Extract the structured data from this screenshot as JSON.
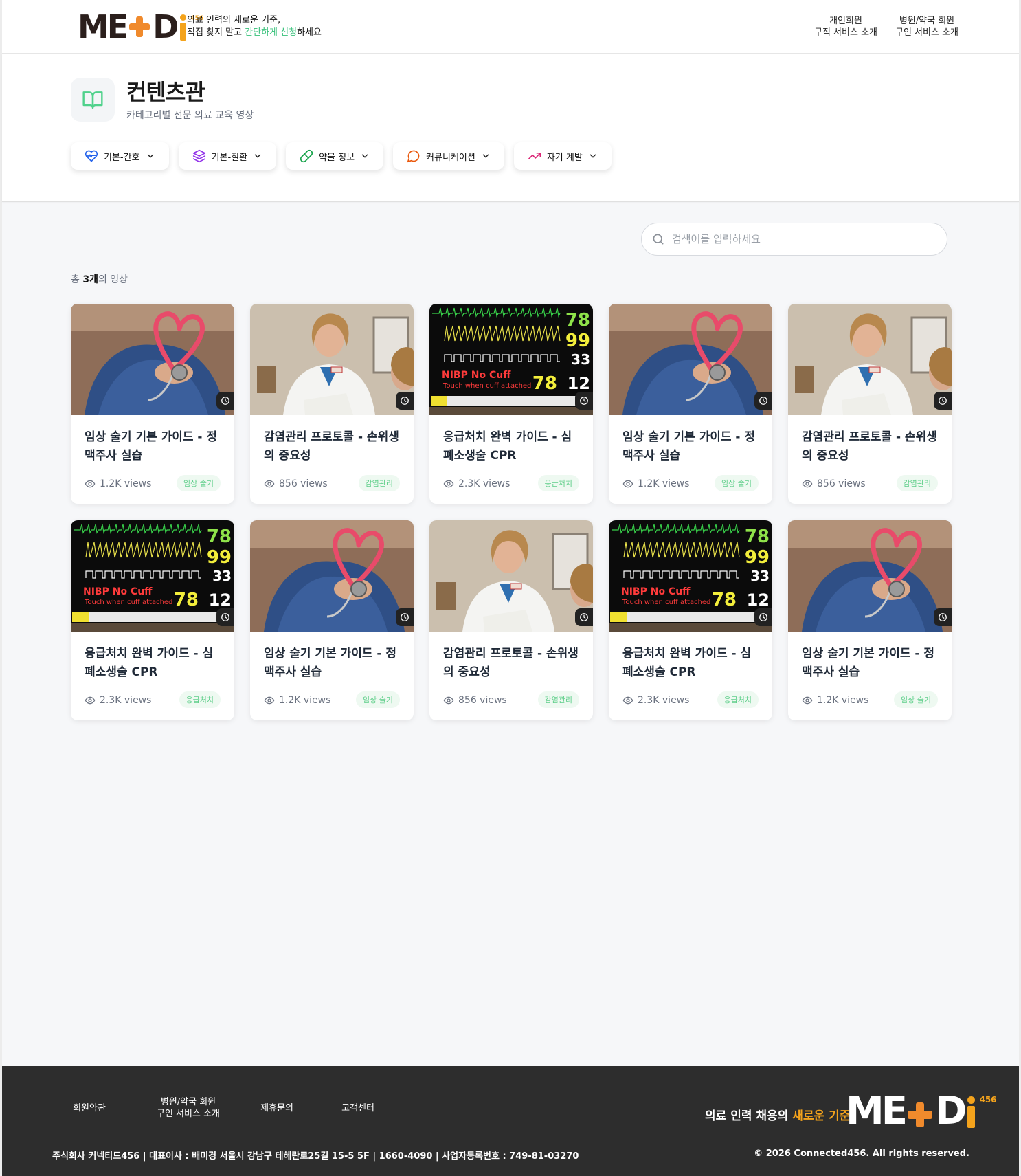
{
  "header": {
    "logo_text": "MEDi",
    "logo_sup": "456",
    "tagline_line1": "의료 인력의 새로운 기준,",
    "tagline_pre": "직접 찾지 말고 ",
    "tagline_green": "간단하게 신청",
    "tagline_post": "하세요",
    "nav": [
      {
        "line1": "개인회원",
        "line2": "구직 서비스 소개"
      },
      {
        "line1": "병원/약국 회원",
        "line2": "구인 서비스 소개"
      }
    ]
  },
  "hero": {
    "icon": "book-open-icon",
    "title": "컨텐츠관",
    "subtitle": "카테고리별 전문 의료 교육 영상",
    "categories": [
      {
        "label": "기본-간호",
        "icon": "heart-pulse-icon",
        "color": "#2563eb"
      },
      {
        "label": "기본-질환",
        "icon": "layers-icon",
        "color": "#9333ea"
      },
      {
        "label": "약물 정보",
        "icon": "pill-icon",
        "color": "#16a34a"
      },
      {
        "label": "커뮤니케이션",
        "icon": "message-circle-icon",
        "color": "#ea580c"
      },
      {
        "label": "자기 계발",
        "icon": "trending-up-icon",
        "color": "#db2777"
      }
    ]
  },
  "search": {
    "placeholder": "검색어를 입력하세요"
  },
  "count": {
    "prefix": "총 ",
    "value": "3개",
    "suffix": "의 영상"
  },
  "videos": [
    {
      "title": "임상 술기 기본 가이드 - 정맥주사 실습",
      "views": "1.2K views",
      "tag": "임상 술기",
      "thumb": "heart"
    },
    {
      "title": "감염관리 프로토콜 - 손위생의 중요성",
      "views": "856 views",
      "tag": "감염관리",
      "thumb": "doctor"
    },
    {
      "title": "응급처치 완벽 가이드 - 심폐소생술 CPR",
      "views": "2.3K views",
      "tag": "응급처치",
      "thumb": "monitor"
    },
    {
      "title": "임상 술기 기본 가이드 - 정맥주사 실습",
      "views": "1.2K views",
      "tag": "임상 술기",
      "thumb": "heart"
    },
    {
      "title": "감염관리 프로토콜 - 손위생의 중요성",
      "views": "856 views",
      "tag": "감염관리",
      "thumb": "doctor"
    },
    {
      "title": "응급처치 완벽 가이드 - 심폐소생술 CPR",
      "views": "2.3K views",
      "tag": "응급처치",
      "thumb": "monitor"
    },
    {
      "title": "임상 술기 기본 가이드 - 정맥주사 실습",
      "views": "1.2K views",
      "tag": "임상 술기",
      "thumb": "heart"
    },
    {
      "title": "감염관리 프로토콜 - 손위생의 중요성",
      "views": "856 views",
      "tag": "감염관리",
      "thumb": "doctor"
    },
    {
      "title": "응급처치 완벽 가이드 - 심폐소생술 CPR",
      "views": "2.3K views",
      "tag": "응급처치",
      "thumb": "monitor"
    },
    {
      "title": "임상 술기 기본 가이드 - 정맥주사 실습",
      "views": "1.2K views",
      "tag": "임상 술기",
      "thumb": "heart"
    }
  ],
  "monitor": {
    "hr": "78",
    "spo2": "99",
    "etco2": "33",
    "pulse": "78",
    "awrr": "12",
    "alarm": "NIBP No Cuff",
    "alarm_sub": "Touch when cuff attached"
  },
  "footer": {
    "links": [
      {
        "line1": "회원약관",
        "line2": ""
      },
      {
        "line1": "병원/약국 회원",
        "line2": "구인 서비스 소개"
      },
      {
        "line1": "제휴문의",
        "line2": ""
      },
      {
        "line1": "고객센터",
        "line2": ""
      }
    ],
    "slogan_pre": "의료 인력 채용의 ",
    "slogan_orange": "새로운 기준",
    "logo_text": "MEDi",
    "logo_sup": "456",
    "company_info": "주식회사 커넥티드456 | 대표이사 : 배미경 서울시 강남구 테헤란로25길 15-5 5F | 1660-4090 | 사업자등록번호 : 749-81-03270",
    "copyright": "© 2026 Connected456. All rights reserved."
  }
}
